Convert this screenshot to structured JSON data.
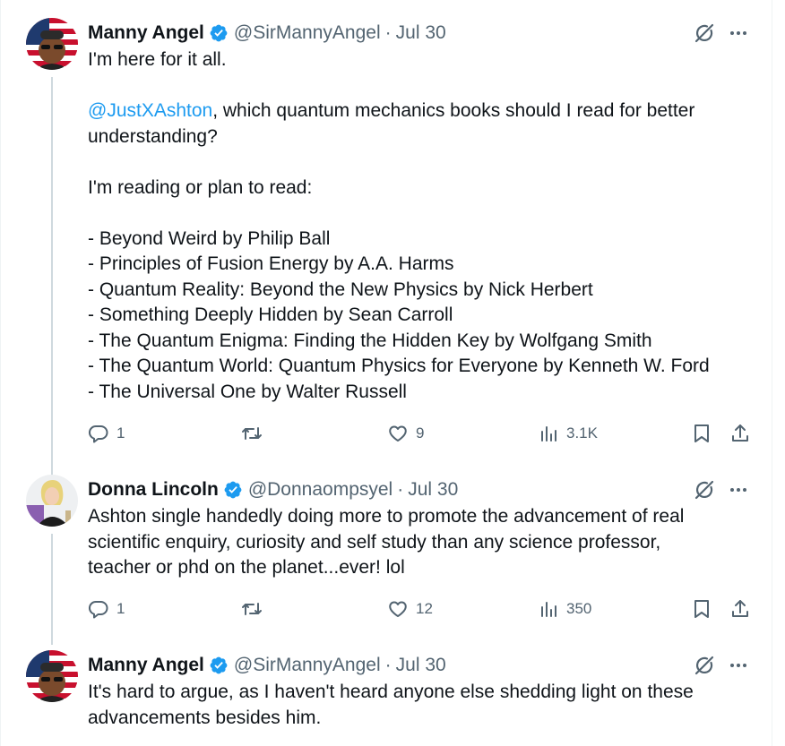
{
  "tweets": [
    {
      "name": "Manny Angel",
      "handle": "@SirMannyAngel",
      "separator": "·",
      "date": "Jul 30",
      "lines": [
        "I'm here for it all.",
        "",
        ", which quantum mechanics books should I read for better",
        "understanding?",
        "",
        "I'm reading or plan to read:",
        "",
        "- Beyond Weird by Philip Ball",
        "- Principles of Fusion Energy by A.A. Harms",
        "- Quantum Reality: Beyond the New Physics by Nick Herbert",
        "- Something Deeply Hidden by Sean Carroll",
        "- The Quantum Enigma: Finding the Hidden Key by Wolfgang Smith",
        "- The Quantum World: Quantum Physics for Everyone by Kenneth W. Ford",
        "- The Universal One by Walter Russell"
      ],
      "mention": "@JustXAshton",
      "replies": "1",
      "reposts": "",
      "likes": "9",
      "views": "3.1K"
    },
    {
      "name": "Donna Lincoln",
      "handle": "@Donnaompsyel",
      "separator": "·",
      "date": "Jul 30",
      "lines": [
        "Ashton single handedly doing more to promote the advancement of real",
        "scientific enquiry, curiosity and self study than any science professor,",
        "teacher or phd on the planet...ever! lol"
      ],
      "replies": "1",
      "reposts": "",
      "likes": "12",
      "views": "350"
    },
    {
      "name": "Manny Angel",
      "handle": "@SirMannyAngel",
      "separator": "·",
      "date": "Jul 30",
      "lines": [
        "It's hard to argue, as I haven't heard anyone else shedding light on these",
        "advancements besides him."
      ]
    }
  ],
  "colors": {
    "accent": "#1d9bf0",
    "muted": "#536471",
    "text": "#0f1419",
    "thread": "#cfd9de"
  },
  "icons": [
    "verified-badge-icon",
    "grok-icon",
    "more-icon",
    "reply-icon",
    "repost-icon",
    "like-icon",
    "views-icon",
    "bookmark-icon",
    "share-icon"
  ]
}
